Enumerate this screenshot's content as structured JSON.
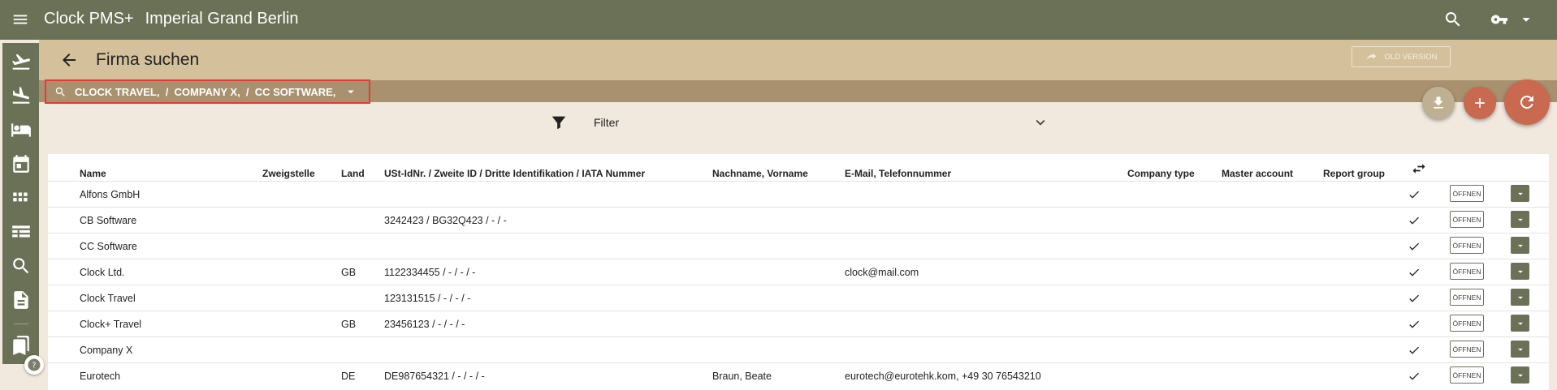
{
  "app": {
    "name": "Clock PMS+",
    "hotel": "Imperial Grand Berlin"
  },
  "header": {
    "title": "Firma suchen",
    "old_version_label": "OLD VERSION"
  },
  "search": {
    "chip_text": "CLOCK TRAVEL,  /  COMPANY X,  /  CC SOFTWARE,"
  },
  "filter": {
    "label": "Filter"
  },
  "table": {
    "columns": [
      "Name",
      "Zweigstelle",
      "Land",
      "USt-IdNr. / Zweite ID / Dritte Identifikation / IATA Nummer",
      "Nachname, Vorname",
      "E-Mail, Telefonnummer",
      "Company type",
      "Master account",
      "Report group"
    ],
    "open_label": "ÖFFNEN",
    "rows": [
      {
        "name": "Alfons GmbH",
        "branch": "",
        "country": "",
        "ids": "",
        "contact": "",
        "email": ""
      },
      {
        "name": "CB Software",
        "branch": "",
        "country": "",
        "ids": "3242423 / BG32Q423 / - / -",
        "contact": "",
        "email": ""
      },
      {
        "name": "CC Software",
        "branch": "",
        "country": "",
        "ids": "",
        "contact": "",
        "email": ""
      },
      {
        "name": "Clock Ltd.",
        "branch": "",
        "country": "GB",
        "ids": "1122334455 / - / - / -",
        "contact": "",
        "email": "clock@mail.com"
      },
      {
        "name": "Clock Travel",
        "branch": "",
        "country": "",
        "ids": "123131515 / - / - / -",
        "contact": "",
        "email": ""
      },
      {
        "name": "Clock+ Travel",
        "branch": "",
        "country": "GB",
        "ids": "23456123 / - / - / -",
        "contact": "",
        "email": ""
      },
      {
        "name": "Company X",
        "branch": "",
        "country": "",
        "ids": "",
        "contact": "",
        "email": ""
      },
      {
        "name": "Eurotech",
        "branch": "",
        "country": "DE",
        "ids": "DE987654321 / - / - / -",
        "contact": "Braun, Beate",
        "email": "eurotech@eurotehk.kom, +49 30 76543210"
      }
    ]
  },
  "colors": {
    "topbar": "#6b7157",
    "header_band": "#d4c19c",
    "search_band": "#a9916f",
    "accent": "#c9694f",
    "highlight_border": "#e53935",
    "background": "#f1e9de"
  },
  "icons": {
    "sidebar": [
      "flight-takeoff-icon",
      "flight-land-icon",
      "bed-icon",
      "calendar-icon",
      "grid-icon",
      "table-icon",
      "search-icon",
      "document-icon",
      "bookmarks-icon"
    ],
    "top": [
      "menu-icon",
      "search-icon",
      "key-icon",
      "caret-down-icon"
    ]
  }
}
